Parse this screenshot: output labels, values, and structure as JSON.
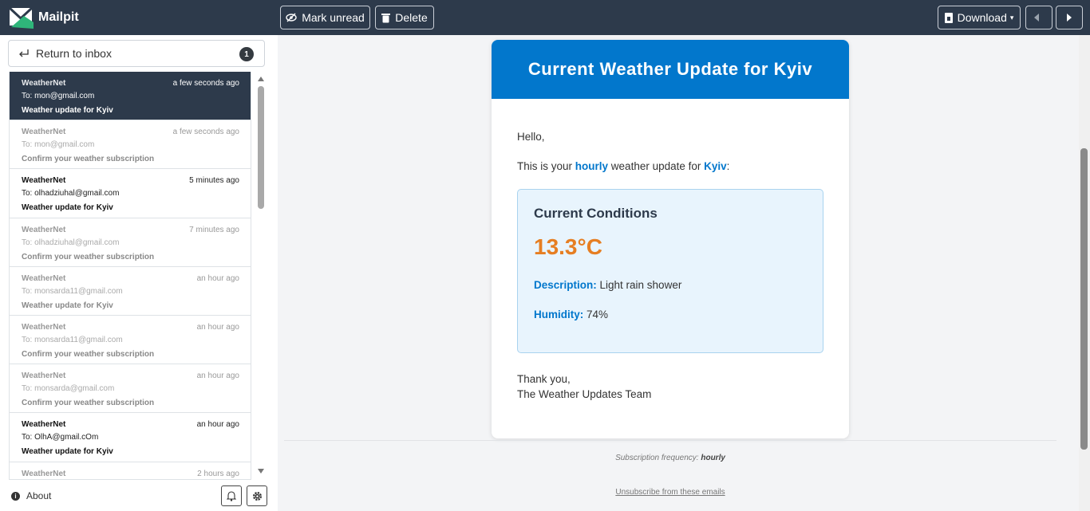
{
  "app": {
    "name": "Mailpit"
  },
  "toolbar": {
    "mark_unread": "Mark unread",
    "delete": "Delete",
    "download": "Download"
  },
  "sidebar": {
    "return_label": "Return to inbox",
    "unread_count": "1",
    "about": "About",
    "messages": [
      {
        "from": "WeatherNet",
        "when": "a few seconds ago",
        "to": "To: mon@gmail.com",
        "subject": "Weather update for Kyiv",
        "state": "active"
      },
      {
        "from": "WeatherNet",
        "when": "a few seconds ago",
        "to": "To: mon@gmail.com",
        "subject": "Confirm your weather subscription",
        "state": "read"
      },
      {
        "from": "WeatherNet",
        "when": "5 minutes ago",
        "to": "To: olhadziuhal@gmail.com",
        "subject": "Weather update for Kyiv",
        "state": "unread"
      },
      {
        "from": "WeatherNet",
        "when": "7 minutes ago",
        "to": "To: olhadziuhal@gmail.com",
        "subject": "Confirm your weather subscription",
        "state": "read"
      },
      {
        "from": "WeatherNet",
        "when": "an hour ago",
        "to": "To: monsarda11@gmail.com",
        "subject": "Weather update for Kyiv",
        "state": "read"
      },
      {
        "from": "WeatherNet",
        "when": "an hour ago",
        "to": "To: monsarda11@gmail.com",
        "subject": "Confirm your weather subscription",
        "state": "read"
      },
      {
        "from": "WeatherNet",
        "when": "an hour ago",
        "to": "To: monsarda@gmail.com",
        "subject": "Confirm your weather subscription",
        "state": "read"
      },
      {
        "from": "WeatherNet",
        "when": "an hour ago",
        "to": "To: OlhA@gmail.cOm",
        "subject": "Weather update for Kyiv",
        "state": "unread"
      },
      {
        "from": "WeatherNet",
        "when": "2 hours ago",
        "to": "",
        "subject": "",
        "state": "read"
      }
    ]
  },
  "email": {
    "header": "Current Weather Update for Kyiv",
    "greeting": "Hello,",
    "intro_prefix": "This is your ",
    "intro_frequency": "hourly",
    "intro_middle": " weather update for ",
    "intro_city": "Kyiv",
    "intro_suffix": ":",
    "conditions_title": "Current Conditions",
    "temperature": "13.3°C",
    "description_label": "Description:",
    "description_value": " Light rain shower",
    "humidity_label": "Humidity:",
    "humidity_value": " 74%",
    "thanks": "Thank you,",
    "signature": "The Weather Updates Team",
    "footer_freq_label": "Subscription frequency: ",
    "footer_freq_value": "hourly",
    "unsubscribe": "Unsubscribe from these emails"
  },
  "colors": {
    "topbar": "#2d3a4b",
    "accent": "#0277cc",
    "temperature": "#e67e22",
    "conditions_bg": "#e8f4fd"
  }
}
